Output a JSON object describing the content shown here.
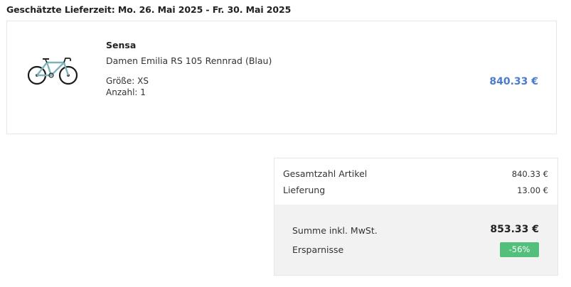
{
  "delivery": {
    "estimate": "Geschätzte Lieferzeit: Mo. 26. Mai 2025 - Fr. 30. Mai 2025"
  },
  "product": {
    "image_icon": "bicycle-icon",
    "brand": "Sensa",
    "name": "Damen Emilia RS 105 Rennrad (Blau)",
    "size": "Größe: XS",
    "quantity": "Anzahl: 1",
    "price": "840.33 €",
    "price_color": "#4a7bd0"
  },
  "summary": {
    "items_label": "Gesamtzahl Artikel",
    "items_value": "840.33 €",
    "delivery_label": "Lieferung",
    "delivery_value": "13.00 €",
    "total_label": "Summe inkl. MwSt.",
    "total_value": "853.33 €",
    "savings_label": "Ersparnisse",
    "savings_value": "-56%",
    "savings_color": "#52c07a"
  }
}
